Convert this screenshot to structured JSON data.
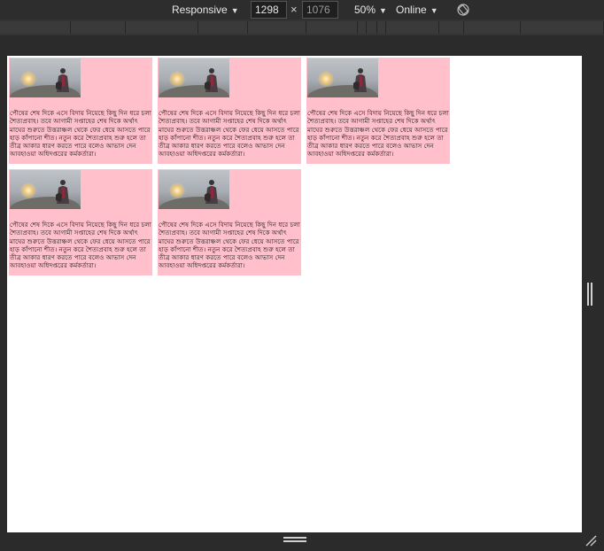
{
  "toolbar": {
    "device_mode": "Responsive",
    "width_value": "1298",
    "height_value": "1076",
    "times_symbol": "×",
    "zoom": "50%",
    "network": "Online",
    "rotate_icon": "rotate-icon"
  },
  "colors": {
    "card_background": "#ffc0cb",
    "toolbar_background": "#2d2d2d",
    "viewport_background": "#ffffff"
  },
  "cards": [
    {
      "text": "পৌষের শেষ দিকে এসে বিদায় নিয়েছে কিছু দিন ধরে চলা শৈত্যপ্রবাহ। তবে আগামী সপ্তাহের শেষ দিকে অর্থাৎ মাঘের শুরুতে উত্তরাঞ্চল থেকে ফের ধেয়ে আসতে পারে হাড় কাঁপানো শীত। নতুন করে শৈত্যপ্রবাহ শুরু হলে তা তীব্র আকার ধারণ করতে পারে বলেও আভাস দেন আবহাওয়া অধিদপ্তরের কর্মকর্তারা।"
    },
    {
      "text": "পৌষের শেষ দিকে এসে বিদায় নিয়েছে কিছু দিন ধরে চলা শৈত্যপ্রবাহ। তবে আগামী সপ্তাহের শেষ দিকে অর্থাৎ মাঘের শুরুতে উত্তরাঞ্চল থেকে ফের ধেয়ে আসতে পারে হাড় কাঁপানো শীত। নতুন করে শৈত্যপ্রবাহ শুরু হলে তা তীব্র আকার ধারণ করতে পারে বলেও আভাস দেন আবহাওয়া অধিদপ্তরের কর্মকর্তারা।"
    },
    {
      "text": "পৌষের শেষ দিকে এসে বিদায় নিয়েছে কিছু দিন ধরে চলা শৈত্যপ্রবাহ। তবে আগামী সপ্তাহের শেষ দিকে অর্থাৎ মাঘের শুরুতে উত্তরাঞ্চল থেকে ফের ধেয়ে আসতে পারে হাড় কাঁপানো শীত। নতুন করে শৈত্যপ্রবাহ শুরু হলে তা তীব্র আকার ধারণ করতে পারে বলেও আভাস দেন আবহাওয়া অধিদপ্তরের কর্মকর্তারা।"
    },
    {
      "text": "পৌষের শেষ দিকে এসে বিদায় নিয়েছে কিছু দিন ধরে চলা শৈত্যপ্রবাহ। তবে আগামী সপ্তাহের শেষ দিকে অর্থাৎ মাঘের শুরুতে উত্তরাঞ্চল থেকে ফের ধেয়ে আসতে পারে হাড় কাঁপানো শীত। নতুন করে শৈত্যপ্রবাহ শুরু হলে তা তীব্র আকার ধারণ করতে পারে বলেও আভাস দেন আবহাওয়া অধিদপ্তরের কর্মকর্তারা।"
    },
    {
      "text": "পৌষের শেষ দিকে এসে বিদায় নিয়েছে কিছু দিন ধরে চলা শৈত্যপ্রবাহ। তবে আগামী সপ্তাহের শেষ দিকে অর্থাৎ মাঘের শুরুতে উত্তরাঞ্চল থেকে ফের ধেয়ে আসতে পারে হাড় কাঁপানো শীত। নতুন করে শৈত্যপ্রবাহ শুরু হলে তা তীব্র আকার ধারণ করতে পারে বলেও আভাস দেন আবহাওয়া অধিদপ্তরের কর্মকর্তারা।"
    }
  ]
}
